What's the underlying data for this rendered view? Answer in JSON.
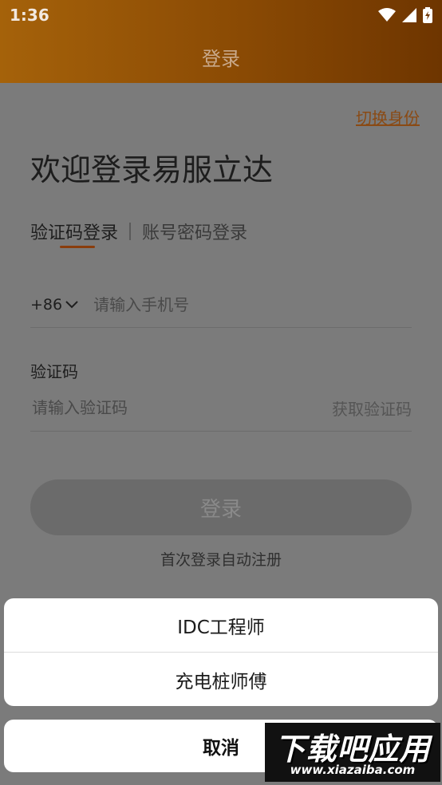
{
  "status_bar": {
    "time": "1:36"
  },
  "app_bar": {
    "title": "登录"
  },
  "switch_role": "切换身份",
  "welcome": "欢迎登录易服立达",
  "tabs": {
    "active": "验证码登录",
    "inactive": "账号密码登录"
  },
  "phone": {
    "country_code": "+86",
    "placeholder": "请输入手机号"
  },
  "code": {
    "label": "验证码",
    "placeholder": "请输入验证码",
    "get_code": "获取验证码"
  },
  "login_button": "登录",
  "auto_register": "首次登录自动注册",
  "sheet": {
    "options": [
      "IDC工程师",
      "充电桩师傅"
    ],
    "cancel": "取消"
  },
  "watermark": {
    "title": "下载吧应用",
    "url": "www.xiazaiba.com"
  },
  "colors": {
    "header_start": "#a5620a",
    "header_end": "#6e3500",
    "accent": "#8a3d0c"
  }
}
